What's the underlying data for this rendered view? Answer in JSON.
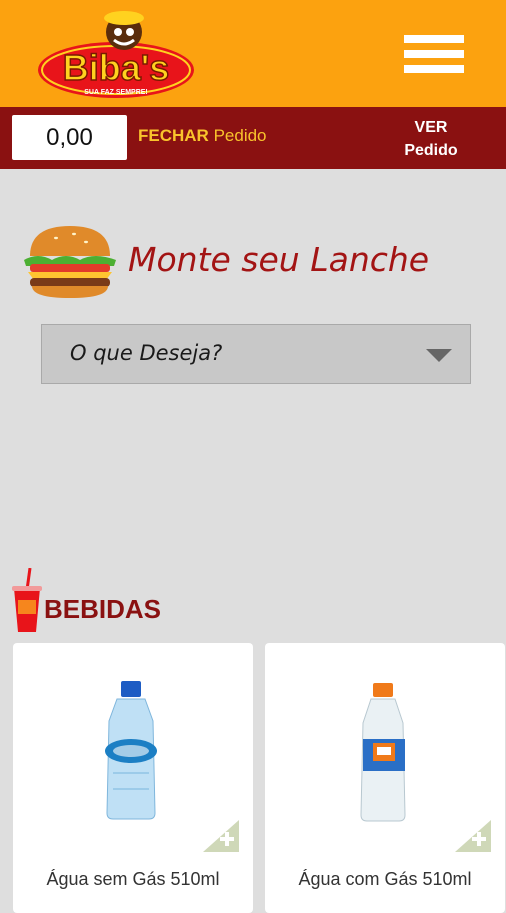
{
  "header": {
    "logo_text": "Biba's",
    "logo_tagline": "SUA FAZ SEMPRE!",
    "menu_icon": "hamburger-icon"
  },
  "order_bar": {
    "total": "0,00",
    "close_label_bold": "FECHAR",
    "close_label": "Pedido",
    "view_label_1": "VER",
    "view_label_2": "Pedido"
  },
  "builder": {
    "title": "Monte seu Lanche",
    "select_value": "O que Deseja?",
    "icon": "burger-icon"
  },
  "drinks": {
    "title": "BEBIDAS",
    "icon": "soda-cup-icon",
    "items": [
      {
        "name": "Água sem Gás 510ml",
        "icon": "water-bottle-icon",
        "cap_color": "#1d5cc4"
      },
      {
        "name": "Água com Gás 510ml",
        "icon": "sparkling-water-bottle-icon",
        "cap_color": "#f07a1a"
      }
    ]
  },
  "colors": {
    "header_bg": "#fca20f",
    "order_bar_bg": "#8a1111",
    "accent_yellow": "#f9c32c",
    "title_red": "#a31414",
    "page_bg": "#dedede"
  }
}
